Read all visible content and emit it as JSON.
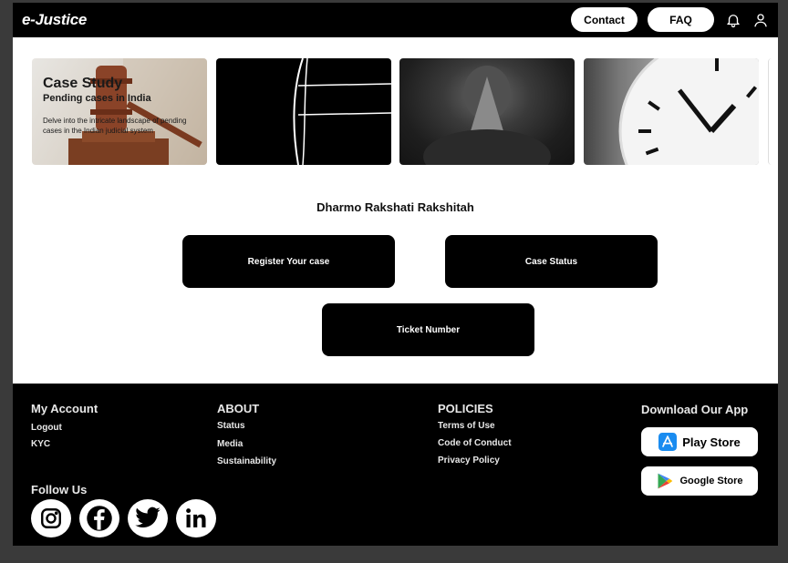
{
  "header": {
    "logo": "e-Justice",
    "contact_label": "Contact",
    "faq_label": "FAQ",
    "bell_icon": "bell-icon",
    "user_icon": "user-icon"
  },
  "carousel": {
    "card1": {
      "title": "Case Study",
      "subtitle": "Pending cases in India",
      "description": "Delve into the intricate landscape of pending cases in the Indian judicial system"
    }
  },
  "main": {
    "motto": "Dharmo Rakshati Rakshitah",
    "register_label": "Register Your case",
    "status_label": "Case Status",
    "ticket_label": "Ticket Number"
  },
  "footer": {
    "my_account": {
      "heading": "My Account",
      "links": [
        "Logout",
        "KYC"
      ]
    },
    "about": {
      "heading": "ABOUT",
      "links": [
        "Status",
        "Media",
        "Sustainability"
      ]
    },
    "policies": {
      "heading": "POLICIES",
      "links": [
        "Terms of Use",
        "Code of Conduct",
        "Privacy Policy"
      ]
    },
    "app": {
      "heading": "Download Our App",
      "play_store": "Play Store",
      "google_store": "Google Store"
    },
    "follow": {
      "heading": "Follow Us",
      "icons": [
        "instagram-icon",
        "facebook-icon",
        "twitter-icon",
        "linkedin-icon"
      ]
    }
  }
}
